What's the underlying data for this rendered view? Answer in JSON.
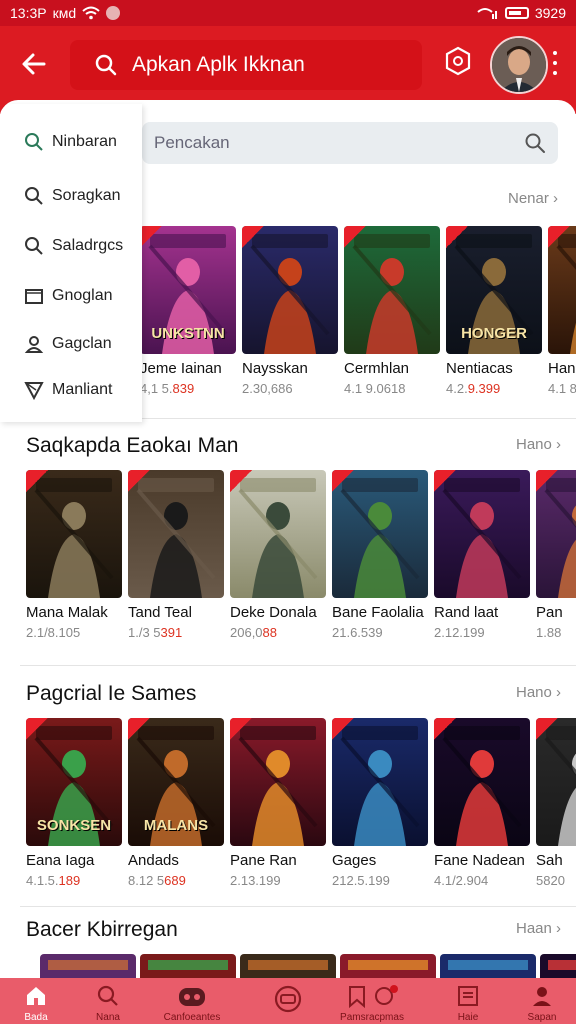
{
  "status_bar": {
    "time": "13:3P",
    "carrier": "кмd",
    "right_text": "3929"
  },
  "app_bar": {
    "search_text": "Apkan Aplk Ikknan"
  },
  "search": {
    "placeholder": "Pencakan"
  },
  "drawer": {
    "items": [
      "Ninbaran",
      "Soragkan",
      "Saladrgcs",
      "Gnoglan",
      "Gagclan",
      "Manliant"
    ]
  },
  "sections": [
    {
      "title": "",
      "more": "Nenar",
      "items": [
        {
          "name": "Jeme Iainan",
          "count": "4,1 5.",
          "count_red": "839",
          "tag": "UNKSTNN"
        },
        {
          "name": "Naysskan",
          "count": "2.30,686",
          "count_red": "",
          "tag": ""
        },
        {
          "name": "Cermhlan",
          "count": "4.1 9.0618",
          "count_red": "",
          "tag": ""
        },
        {
          "name": "Nentiacas",
          "count": "4.2.",
          "count_red": "9.399",
          "tag": "HONGER"
        },
        {
          "name": "Han",
          "count": "4.1 8",
          "count_red": "",
          "tag": ""
        }
      ]
    },
    {
      "title": "Saqkapda Eaokaı Man",
      "more": "Hano",
      "items": [
        {
          "name": "Mana Malak",
          "count": "2.1/8.105",
          "count_red": "",
          "tag": ""
        },
        {
          "name": "Tand Teal",
          "count": "1./3 5",
          "count_red": "391",
          "tag": ""
        },
        {
          "name": "Deke Donala",
          "count": "206,0",
          "count_red": "88",
          "tag": ""
        },
        {
          "name": "Bane Faolalia",
          "count": "21.6.539",
          "count_red": "",
          "tag": ""
        },
        {
          "name": "Rand laat",
          "count": "2.12.199",
          "count_red": "",
          "tag": ""
        },
        {
          "name": "Pan",
          "count": "1.88",
          "count_red": "",
          "tag": ""
        }
      ]
    },
    {
      "title": "Pagcrial Ie Sames",
      "more": "Hano",
      "items": [
        {
          "name": "Eana Iaga",
          "count": "4.1.5.",
          "count_red": "189",
          "tag": "SONKSEN"
        },
        {
          "name": "Andads",
          "count": "8.12 5",
          "count_red": "689",
          "tag": "MALANS"
        },
        {
          "name": "Pane Ran",
          "count": "2.13.199",
          "count_red": "",
          "tag": ""
        },
        {
          "name": "Gages",
          "count": "212.5.199",
          "count_red": "",
          "tag": ""
        },
        {
          "name": "Fane Nadean",
          "count": "4.1/2.904",
          "count_red": "",
          "tag": ""
        },
        {
          "name": "Sah",
          "count": "5820",
          "count_red": "",
          "tag": ""
        }
      ]
    },
    {
      "title": "Bacer Kbirregan",
      "more": "Haan"
    }
  ],
  "bottom_nav": [
    {
      "label": "Bada",
      "icon": "home-icon"
    },
    {
      "label": "Nana",
      "icon": "search-icon"
    },
    {
      "label": "Canfoeantes",
      "icon": "gamepad-icon"
    },
    {
      "label": "",
      "icon": "badge-icon"
    },
    {
      "label": "Pamsracpmas",
      "icon": "bookmark-chat-icon"
    },
    {
      "label": "Haie",
      "icon": "list-icon"
    },
    {
      "label": "Sapan",
      "icon": "person-icon"
    }
  ],
  "colors": {
    "primary": "#dc1b22",
    "bottom_nav": "#e95c6a"
  }
}
